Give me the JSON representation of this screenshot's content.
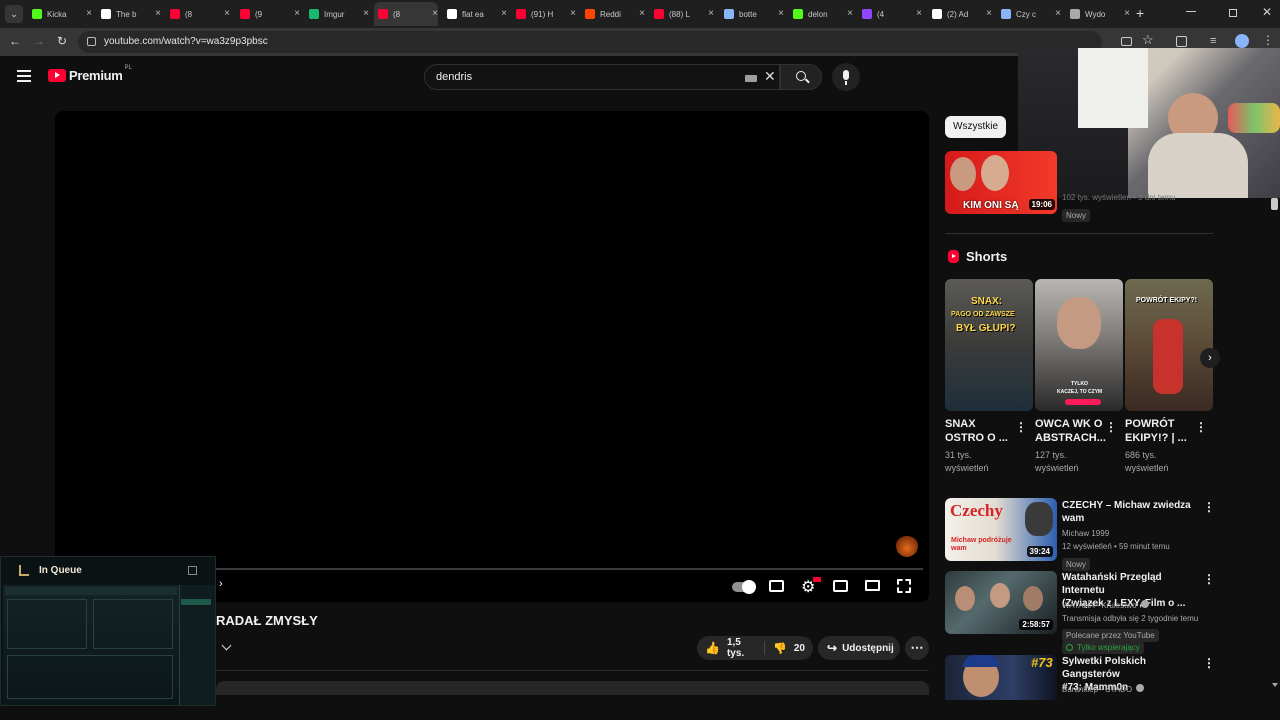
{
  "browser": {
    "tabs": [
      {
        "label": "Kicka",
        "color": "#53fc18"
      },
      {
        "label": "The b",
        "color": "#ffffff"
      },
      {
        "label": "(8",
        "color": "#ff0033"
      },
      {
        "label": "(9",
        "color": "#ff0033"
      },
      {
        "label": "Imgur",
        "color": "#1bb76e"
      },
      {
        "label": "(8",
        "color": "#ff0033"
      },
      {
        "label": "flat ea",
        "color": "#ffffff"
      },
      {
        "label": "(91) H",
        "color": "#ff0033"
      },
      {
        "label": "Reddi",
        "color": "#ff4500"
      },
      {
        "label": "(88) L",
        "color": "#ff0033"
      },
      {
        "label": "botte",
        "color": "#8ab4f8"
      },
      {
        "label": "delon",
        "color": "#53fc18"
      },
      {
        "label": "(4",
        "color": "#9146ff"
      },
      {
        "label": "(2) Ad",
        "color": "#ffffff"
      },
      {
        "label": "Czy c",
        "color": "#8ab4f8"
      },
      {
        "label": "Wydo",
        "color": "#aaaaaa"
      }
    ],
    "url": "youtube.com/watch?v=wa3z9p3pbsc"
  },
  "youtube": {
    "logo_text": "Premium",
    "region": "PL",
    "search_value": "dendris",
    "video_title_fragment": "RADAŁ ZMYSŁY",
    "likes": "1,5 tys.",
    "dislikes": "20",
    "share_label": "Udostępnij"
  },
  "queue": {
    "label": "In Queue"
  },
  "sidebar": {
    "chip": "Wszystkie",
    "top_video": {
      "duration": "19:06",
      "thumb_text": "KIM ONI SĄ",
      "meta": "102 tys. wyświetleń • 3 dni temu",
      "badge": "Nowy"
    },
    "shorts_title": "Shorts",
    "shorts": [
      {
        "title_line1": "SNAX",
        "title_line2": "OSTRO O ...",
        "views_line1": "31 tys.",
        "views_line2": "wyświetleń",
        "thumb_top": "SNAX:",
        "thumb_mid": "PAGO OD ZAWSZE",
        "thumb_bottom": "BYŁ GŁUPI?"
      },
      {
        "title_line1": "OWCA WK O",
        "title_line2": "ABSTRACH...",
        "views_line1": "127 tys.",
        "views_line2": "wyświetleń",
        "thumb_top": "TYLKO",
        "thumb_mid": "KACZEJ, TO CZYM",
        "thumb_bottom": ""
      },
      {
        "title_line1": "POWRÓT",
        "title_line2": "EKIPY!? | ...",
        "views_line1": "686 tys.",
        "views_line2": "wyświetleń",
        "thumb_top": "POWRÓT EKIPY?!",
        "thumb_mid": "",
        "thumb_bottom": ""
      }
    ],
    "videos": [
      {
        "title_line1": "CZECHY – Michaw zwiedza",
        "title_line2": "wam",
        "channel": "Michaw 1999",
        "meta": "12 wyświetleń • 59 minut temu",
        "badge": "Nowy",
        "duration": "39:24",
        "thumb_big": "Czechy",
        "thumb_sub": "Michaw podróżuje wam"
      },
      {
        "title_line1": "Watahański Przegląd Internetu",
        "title_line2": "(Związek z LEXY, Film o ...",
        "channel": "WATAHA - Krulestwo",
        "meta": "Transmisja odbyła się 2 tygodnie temu",
        "badge": "Polecane przez YouTube",
        "badge2": "Tylko wspierający",
        "duration": "2:58:57"
      },
      {
        "title_line1": "Sylwetki Polskich Gangsterów",
        "title_line2": "#73: Mamm0n",
        "channel": "Barankiep - STADO",
        "thumb_big": "#73"
      }
    ]
  }
}
